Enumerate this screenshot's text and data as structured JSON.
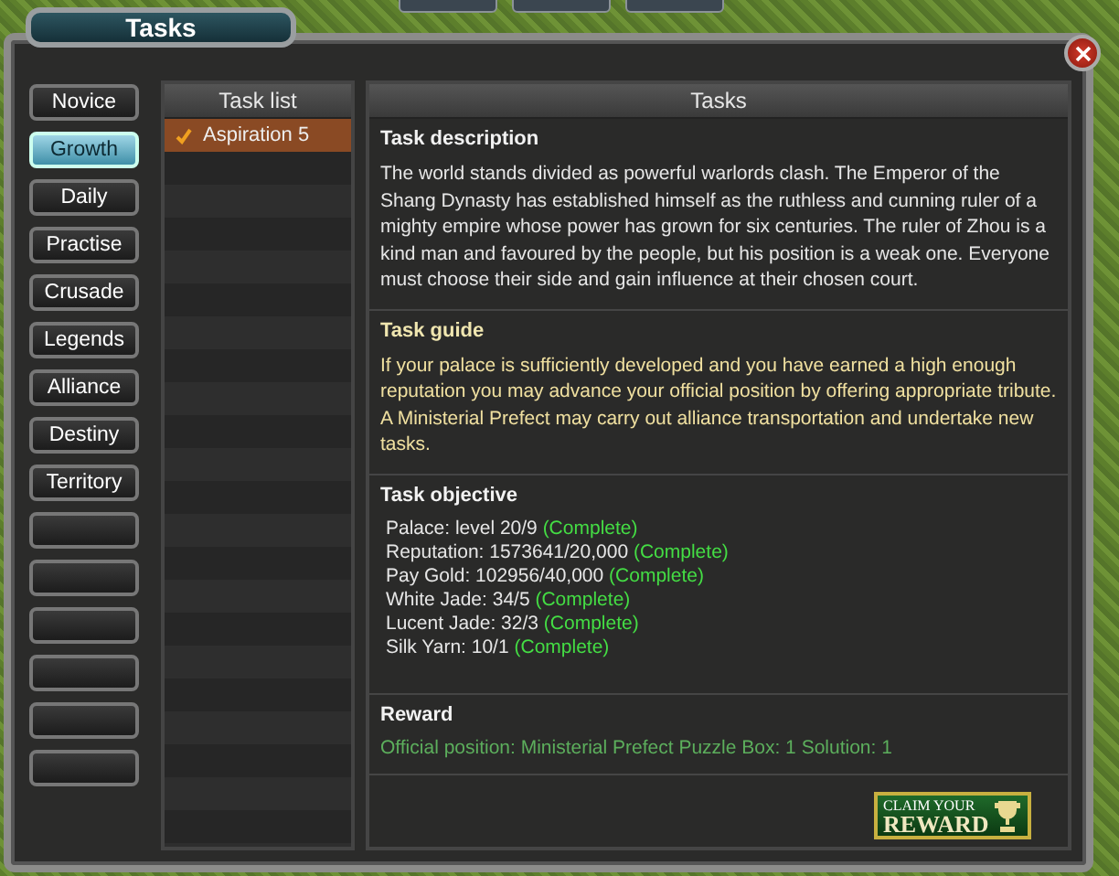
{
  "window": {
    "title": "Tasks"
  },
  "categories": [
    {
      "label": "Novice",
      "selected": false
    },
    {
      "label": "Growth",
      "selected": true
    },
    {
      "label": "Daily",
      "selected": false
    },
    {
      "label": "Practise",
      "selected": false
    },
    {
      "label": "Crusade",
      "selected": false
    },
    {
      "label": "Legends",
      "selected": false
    },
    {
      "label": "Alliance",
      "selected": false
    },
    {
      "label": "Destiny",
      "selected": false
    },
    {
      "label": "Territory",
      "selected": false
    },
    {
      "selected": false
    },
    {
      "selected": false
    },
    {
      "selected": false
    },
    {
      "selected": false
    },
    {
      "selected": false
    },
    {
      "selected": false
    }
  ],
  "task_list": {
    "title": "Task list",
    "items": [
      {
        "label": "Aspiration 5",
        "selected": true,
        "completed": true
      }
    ]
  },
  "details": {
    "title": "Tasks",
    "description": {
      "heading": "Task description",
      "text": "The world stands divided as powerful warlords clash. The Emperor of the Shang Dynasty has established himself as the ruthless and cunning ruler of a mighty empire whose power has grown for six centuries. The ruler of Zhou is a kind man and favoured by the people, but his position is a weak one. Everyone must choose their side and gain influence at their chosen court."
    },
    "guide": {
      "heading": "Task guide",
      "text": "If your palace is sufficiently developed and you have earned a high enough reputation you may advance your official position by  offering appropriate tribute. A Ministerial Prefect may carry out alliance transportation and undertake new tasks."
    },
    "objective": {
      "heading": "Task objective",
      "items": [
        {
          "text": "Palace: level 20/9",
          "status": "(Complete)",
          "complete": true
        },
        {
          "text": "Reputation: 1573641/20,000",
          "status": "(Complete)",
          "complete": true
        },
        {
          "text": "Pay Gold: 102956/40,000",
          "status": "(Complete)",
          "complete": true
        },
        {
          "text": "White Jade: 34/5",
          "status": "(Complete)",
          "complete": true
        },
        {
          "text": "Lucent Jade: 32/3",
          "status": "(Complete)",
          "complete": true
        },
        {
          "text": "Silk Yarn: 10/1",
          "status": "(Complete)",
          "complete": true
        }
      ]
    },
    "reward": {
      "heading": "Reward",
      "text": "Official position: Ministerial Prefect  Puzzle Box: 1  Solution: 1"
    }
  },
  "claim_button": {
    "line1": "CLAIM YOUR",
    "line2": "REWARD"
  }
}
